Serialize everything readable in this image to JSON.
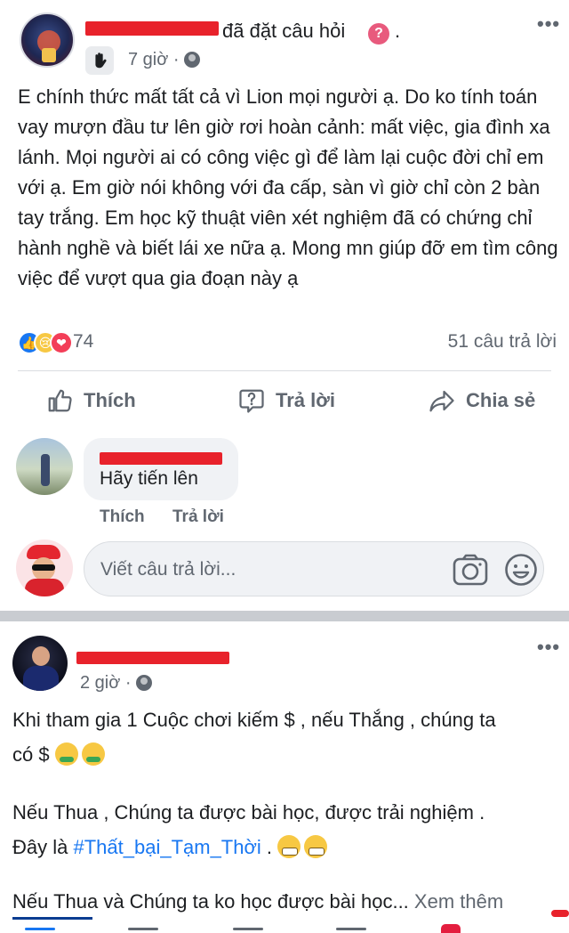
{
  "post1": {
    "action_text": "đã đặt câu hỏi",
    "question_icon": "?",
    "separator_dot": ".",
    "time": "7 giờ ·",
    "body": "E chính thức mất tất cả vì Lion mọi người ạ. Do ko tính toán vay mượn đầu tư lên giờ rơi hoàn cảnh: mất việc, gia đình xa lánh. Mọi người ai có công việc gì để làm lại cuộc đời chỉ em với ạ. Em giờ nói không với đa cấp, sàn vì giờ chỉ còn 2 bàn tay trắng. Em học kỹ thuật viên xét nghiệm đã có chứng chỉ hành nghề và biết lái xe nữa ạ. Mong mn giúp đỡ em tìm công việc để vượt qua gia đoạn này ạ",
    "reaction_count": "74",
    "reply_count": "51 câu trả lời",
    "actions": {
      "like": "Thích",
      "reply": "Trả lời",
      "share": "Chia sẻ"
    },
    "comment": {
      "text": "Hãy tiến lên",
      "like": "Thích",
      "reply": "Trả lời"
    },
    "composer": {
      "placeholder": "Viết câu trả lời..."
    }
  },
  "post2": {
    "time": "2 giờ ·",
    "line1": "Khi tham gia 1 Cuộc chơi kiếm $ , nếu Thắng , chúng ta",
    "line2": "có $",
    "line3": "Nếu Thua , Chúng ta được bài học, được trải nghiệm .",
    "line4_prefix": "Đây là",
    "hashtag": "#Thất_bại_Tạm_Thời",
    "line4_suffix": ".",
    "line5": "Nếu Thua và Chúng ta ko học được bài học...",
    "see_more": "Xem thêm"
  },
  "icons": {
    "more": "more-horizontal-icon",
    "globe": "globe-icon",
    "like": "thumbs-up-icon",
    "reply": "question-bubble-icon",
    "share": "share-arrow-icon",
    "camera": "camera-icon",
    "smiley": "smiley-icon"
  },
  "colors": {
    "brand_blue": "#1877f2",
    "redaction": "#e8222b",
    "muted_text": "#606770",
    "bubble_bg": "#f0f2f5"
  }
}
